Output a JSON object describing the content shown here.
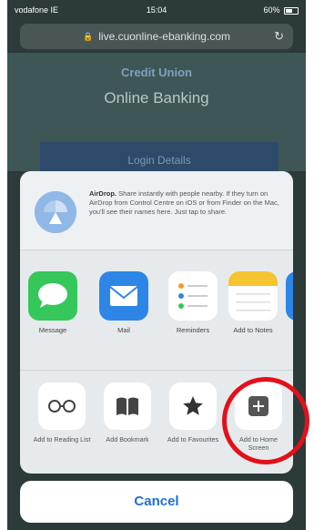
{
  "status_bar": {
    "carrier": "vodafone IE",
    "time": "15:04",
    "battery": "60%"
  },
  "browser": {
    "url": "live.cuonline-ebanking.com"
  },
  "page": {
    "brand": "Credit Union",
    "title": "Online Banking",
    "login_button": "Login Details"
  },
  "share_sheet": {
    "airdrop_title": "AirDrop.",
    "airdrop_text": " Share instantly with people nearby. If they turn on AirDrop from Control Centre on iOS or from Finder on the Mac, you'll see their names here. Just tap to share.",
    "apps": [
      {
        "label": "Message",
        "icon": "messages-icon"
      },
      {
        "label": "Mail",
        "icon": "mail-icon"
      },
      {
        "label": "Reminders",
        "icon": "reminders-icon"
      },
      {
        "label": "Add to Notes",
        "icon": "notes-icon"
      }
    ],
    "actions": [
      {
        "label": "Add to Reading List",
        "icon": "reading-list-icon"
      },
      {
        "label": "Add Bookmark",
        "icon": "bookmark-icon"
      },
      {
        "label": "Add to Favourites",
        "icon": "favourites-star-icon"
      },
      {
        "label": "Add to Home Screen",
        "icon": "add-to-home-screen-icon"
      }
    ],
    "cancel_label": "Cancel"
  },
  "colors": {
    "highlight": "#e3101b",
    "accent": "#1d6fd6"
  }
}
